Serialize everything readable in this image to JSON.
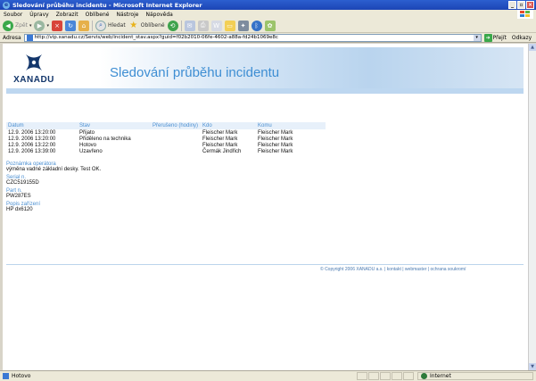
{
  "window": {
    "title": "Sledování průběhu incidentu - Microsoft Internet Explorer"
  },
  "menu": [
    "Soubor",
    "Úpravy",
    "Zobrazit",
    "Oblíbené",
    "Nástroje",
    "Nápověda"
  ],
  "toolbar": {
    "back_label": "Zpět",
    "search_label": "Hledat",
    "favorites_label": "Oblíbené"
  },
  "address": {
    "label": "Adresa",
    "url": "http://vip.xanadu.cz/Servis/web/incident_stav.aspx?guid=f02b2010-06fe-4602-a88a-fd24b1069e8c",
    "go_label": "Přejít",
    "links_label": "Odkazy"
  },
  "page": {
    "logo_text": "XANADU",
    "title": "Sledování průběhu incidentu",
    "table": {
      "headers": [
        "Datum",
        "Stav",
        "Přerušeno (hodiny)",
        "Kdo",
        "Komu"
      ],
      "rows": [
        [
          "12.9. 2006 13:20:00",
          "Přijato",
          "",
          "Fleischer Mark",
          "Fleischer Mark"
        ],
        [
          "12.9. 2006 13:20:00",
          "Přiděleno na technika",
          "",
          "Fleischer Mark",
          "Fleischer Mark"
        ],
        [
          "12.9. 2006 13:22:00",
          "Hotovo",
          "",
          "Fleischer Mark",
          "Fleischer Mark"
        ],
        [
          "12.9. 2006 13:39:00",
          "Uzavřeno",
          "",
          "Čermák Jindřich",
          "Fleischer Mark"
        ]
      ]
    },
    "details": [
      {
        "label": "Poznámka operátora",
        "value": "výměna vadné základní desky. Test OK."
      },
      {
        "label": "Serial n.",
        "value": "CZC519155D"
      },
      {
        "label": "Part n.",
        "value": "PW287ES"
      },
      {
        "label": "Popis zařízení",
        "value": "HP dx6120"
      }
    ],
    "footer": "© Copyright 2006 XANADU a.s. | kontakt | webmaster | ochrana soukromí"
  },
  "status": {
    "text": "Hotovo",
    "zone": "Internet"
  },
  "colors": {
    "accent": "#4b8fd1",
    "title": "#3e8ed3",
    "logo": "#13366b"
  }
}
